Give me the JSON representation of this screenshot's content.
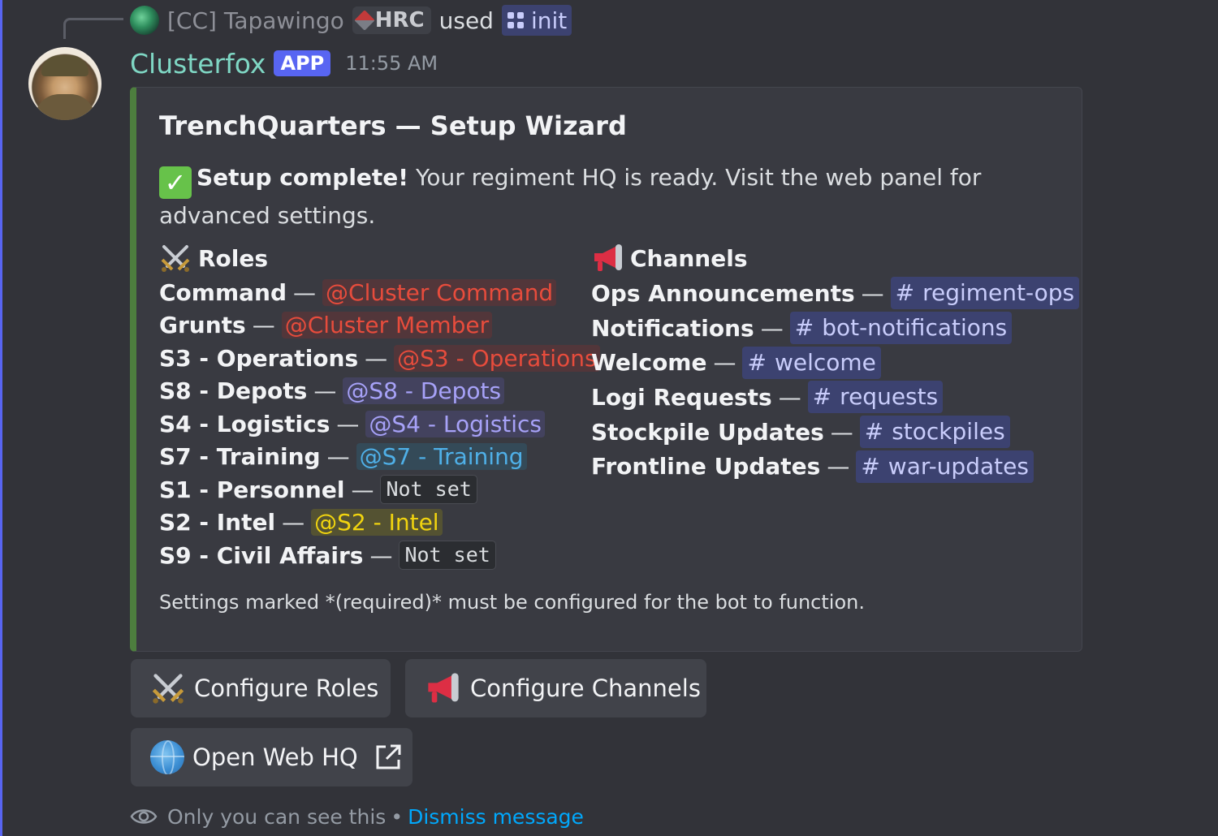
{
  "colors": {
    "accent": "#5865f2",
    "embed_border": "#4d7e3e",
    "username": "#7fd7c4",
    "link": "#00a8fc",
    "mention_red": "#e74c3c",
    "mention_purple": "#a7a2f8",
    "mention_blue": "#4fb0e8",
    "mention_yellow": "#f1d40f"
  },
  "reply": {
    "user": "[CC] Tapawingo",
    "tag": "HRC",
    "verb": "used",
    "command": "init"
  },
  "message": {
    "author": "Clusterfox",
    "badge": "APP",
    "time": "11:55 AM"
  },
  "embed": {
    "title": "TrenchQuarters — Setup Wizard",
    "desc_bold": "Setup complete!",
    "desc_rest": " Your regiment HQ is ready. Visit the web panel for advanced settings.",
    "roles_heading": "Roles",
    "channels_heading": "Channels",
    "roles": [
      {
        "label": "Command",
        "value": "@Cluster Command",
        "style": "red"
      },
      {
        "label": "Grunts",
        "value": "@Cluster Member",
        "style": "red"
      },
      {
        "label": "S3 - Operations",
        "value": "@S3 - Operations",
        "style": "red"
      },
      {
        "label": "S8 - Depots",
        "value": "@S8 - Depots",
        "style": "purple"
      },
      {
        "label": "S4 - Logistics",
        "value": "@S4 - Logistics",
        "style": "purple"
      },
      {
        "label": "S7 - Training",
        "value": "@S7 - Training",
        "style": "blue"
      },
      {
        "label": "S1 - Personnel",
        "value": "Not set",
        "style": "code"
      },
      {
        "label": "S2 - Intel",
        "value": "@S2 - Intel",
        "style": "yellow"
      },
      {
        "label": "S9 - Civil Affairs",
        "value": "Not set",
        "style": "code"
      }
    ],
    "channels": [
      {
        "label": "Ops Announcements",
        "value": "regiment-ops"
      },
      {
        "label": "Notifications",
        "value": "bot-notifications"
      },
      {
        "label": "Welcome",
        "value": "welcome"
      },
      {
        "label": "Logi Requests",
        "value": "requests"
      },
      {
        "label": "Stockpile Updates",
        "value": "stockpiles"
      },
      {
        "label": "Frontline Updates",
        "value": "war-updates"
      }
    ],
    "dash": "—",
    "hash": "#",
    "footer": "Settings marked *(required)* must be configured for the bot to function."
  },
  "buttons": {
    "configure_roles": "Configure Roles",
    "configure_channels": "Configure Channels",
    "open_web": "Open Web HQ"
  },
  "ephemeral": {
    "notice": "Only you can see this",
    "separator": "•",
    "dismiss": "Dismiss message"
  },
  "icons": [
    "swords-icon",
    "megaphone-icon",
    "globe-icon",
    "external-link-icon",
    "eye-icon",
    "check-icon",
    "slash-command-icon"
  ]
}
